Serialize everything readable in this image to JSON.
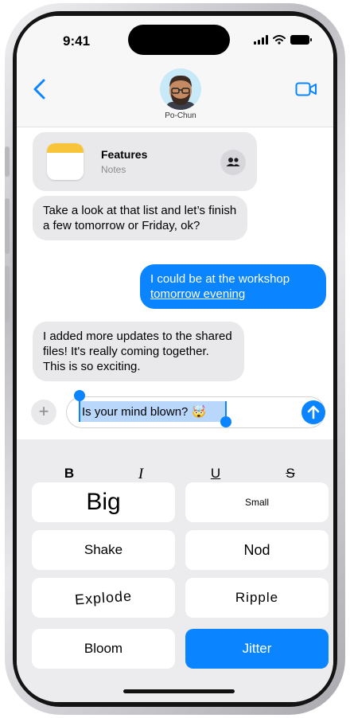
{
  "status_bar": {
    "time": "9:41"
  },
  "header": {
    "contact_name": "Po-Chun"
  },
  "notes_card": {
    "title": "Features",
    "subtitle": "Notes"
  },
  "messages": [
    {
      "type": "received",
      "text": "Take a look at that list and let’s finish a few tomorrow or Friday, ok?"
    },
    {
      "type": "sent",
      "line1": "I could be at the workshop",
      "link": "tomorrow evening"
    },
    {
      "type": "received",
      "text": "I added more updates to the shared files! It's really coming together. This is so exciting."
    }
  ],
  "compose": {
    "plus_label": "+",
    "text": "Is your mind blown? 🤯"
  },
  "formatting": {
    "bold": "B",
    "italic": "I",
    "underline": "U",
    "strikethrough": "S"
  },
  "effects": {
    "big": "Big",
    "small": "Small",
    "shake": "Shake",
    "nod": "Nod",
    "explode": "Explode",
    "ripple": "Ripple",
    "bloom": "Bloom",
    "jitter": "Jitter",
    "selected": "Jitter"
  },
  "colors": {
    "accent": "#0a84ff",
    "bubble_received": "#e9e9eb",
    "panel": "#ececee"
  },
  "icons": [
    "chevron-left-icon",
    "video-camera-icon",
    "people-icon",
    "plus-icon",
    "arrow-up-icon",
    "signal-icon",
    "wifi-icon",
    "battery-icon"
  ]
}
